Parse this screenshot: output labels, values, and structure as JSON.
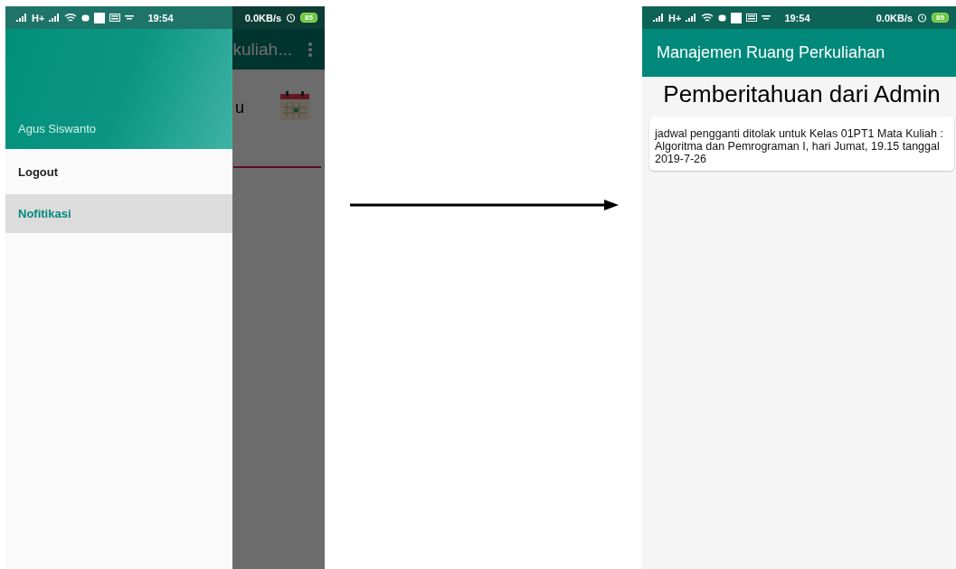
{
  "left_phone": {
    "status_bar": {
      "network": "H+",
      "time": "19:54",
      "speed": "0.0KB/s",
      "battery": "85"
    },
    "background_app": {
      "title": "kuliah...",
      "fragment": "u"
    },
    "drawer": {
      "user_name": "Agus Siswanto",
      "items": [
        {
          "label": "Logout",
          "selected": false
        },
        {
          "label": "Nofitikasi",
          "selected": true
        }
      ]
    }
  },
  "right_phone": {
    "status_bar": {
      "network": "H+",
      "time": "19:54",
      "speed": "0.0KB/s",
      "battery": "85"
    },
    "app_bar": {
      "title": "Manajemen Ruang Perkuliahan"
    },
    "heading": "Pemberitahuan dari Admin",
    "notifications": [
      {
        "text": "jadwal pengganti ditolak untuk Kelas 01PT1 Mata Kuliah : Algoritma dan Pemrograman I, hari Jumat, 19.15 tanggal 2019-7-26"
      }
    ]
  }
}
